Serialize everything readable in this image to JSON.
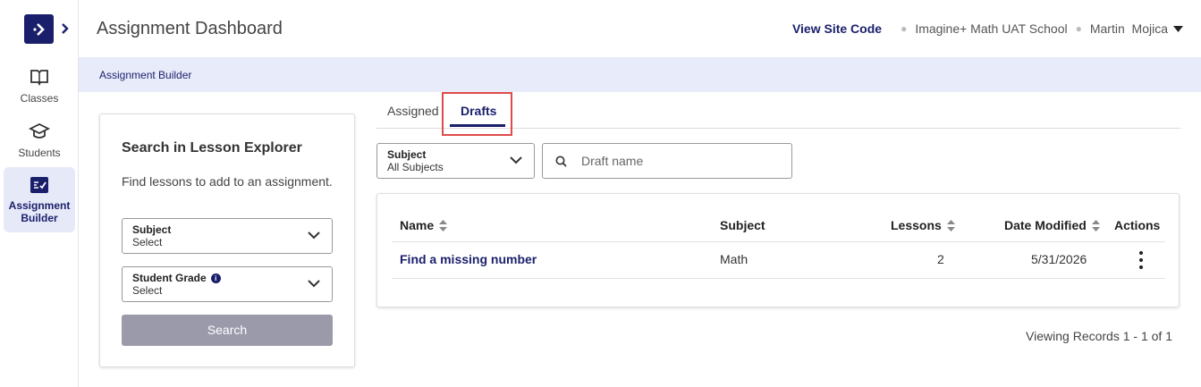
{
  "sidebar": {
    "items": [
      {
        "label": "Classes",
        "icon": "book-icon"
      },
      {
        "label": "Students",
        "icon": "graduation-cap-icon"
      },
      {
        "label": "Assignment Builder",
        "icon": "checklist-icon",
        "active": true
      }
    ]
  },
  "header": {
    "title": "Assignment Dashboard",
    "view_site_code": "View Site Code",
    "school": "Imagine+ Math UAT School",
    "user_name": "Martin  Mojica"
  },
  "breadcrumb": "Assignment Builder",
  "explorer": {
    "title": "Search in Lesson Explorer",
    "description": "Find lessons to add to an assignment.",
    "subject": {
      "label": "Subject",
      "value": "Select"
    },
    "grade": {
      "label": "Student Grade",
      "value": "Select"
    },
    "search_label": "Search"
  },
  "tabs": [
    {
      "label": "Assigned",
      "active": false
    },
    {
      "label": "Drafts",
      "active": true
    }
  ],
  "filters": {
    "subject": {
      "label": "Subject",
      "value": "All Subjects"
    },
    "draft_placeholder": "Draft name"
  },
  "table": {
    "columns": [
      "Name",
      "Subject",
      "Lessons",
      "Date Modified",
      "Actions"
    ],
    "rows": [
      {
        "name": "Find a missing number",
        "subject": "Math",
        "lessons": "2",
        "date": "5/31/2026"
      }
    ]
  },
  "records": "Viewing Records 1 - 1 of 1",
  "colors": {
    "brand": "#1a1f6b",
    "active_bg": "#e6e9f8",
    "highlight": "#e04a4a"
  }
}
